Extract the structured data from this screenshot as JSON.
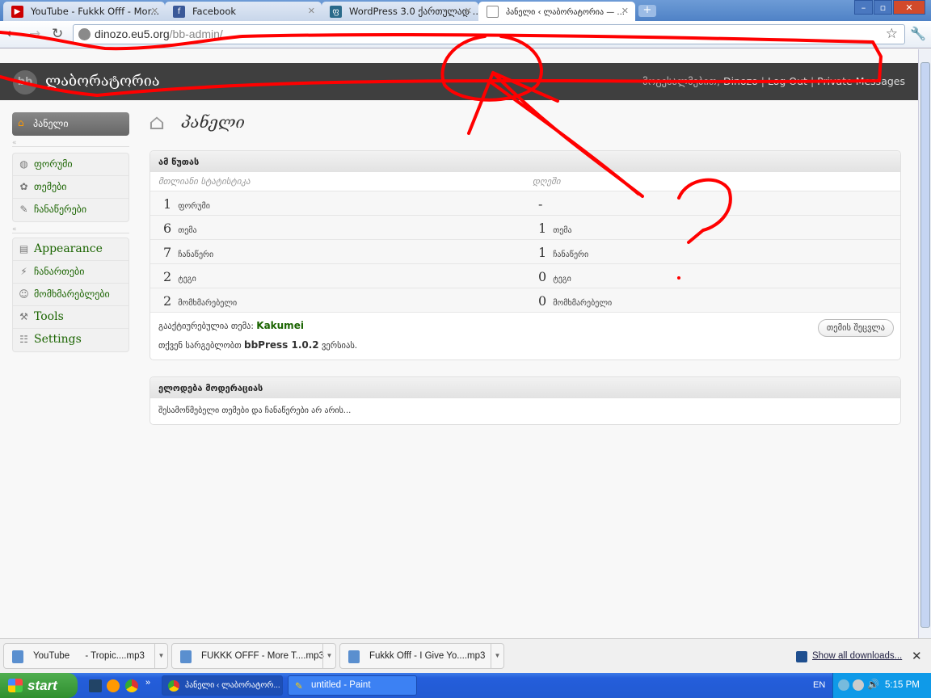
{
  "browser": {
    "tabs": [
      {
        "title": "YouTube - Fukkk Offf - Mor...",
        "icon": "youtube-icon"
      },
      {
        "title": "Facebook",
        "icon": "facebook-icon"
      },
      {
        "title": "WordPress 3.0 ქართულად ...",
        "icon": "wordpress-georgia-icon"
      },
      {
        "title": "პანელი ‹ ლაბორატორია — ...",
        "icon": "page-icon",
        "active": true
      }
    ],
    "url_host": "dinozo.eu5.org",
    "url_path": "/bb-admin/"
  },
  "site": {
    "title": "ლაბორატორია",
    "welcome": "მოგესალმებით, ",
    "username": "Dinozo",
    "logout": "Log Out",
    "messages": "Private Messages",
    "sep": " | "
  },
  "sidebar": {
    "dashboard": "პანელი",
    "group1": [
      "ფორუმი",
      "თემები",
      "ჩანაწერები"
    ],
    "group2": [
      "Appearance",
      "ჩანართები",
      "მომხმარებლები",
      "Tools",
      "Settings"
    ]
  },
  "main": {
    "title": "პანელი",
    "now": {
      "header": "ამ წუთას",
      "col_total": "მთლიანი სტატისტიკა",
      "col_day": "დღეში",
      "rows": [
        {
          "total": "1",
          "total_label": "ფორუმი",
          "day": "-",
          "day_label": ""
        },
        {
          "total": "6",
          "total_label": "თემა",
          "day": "1",
          "day_label": "თემა"
        },
        {
          "total": "7",
          "total_label": "ჩანაწერი",
          "day": "1",
          "day_label": "ჩანაწერი"
        },
        {
          "total": "2",
          "total_label": "ტეგი",
          "day": "0",
          "day_label": "ტეგი"
        },
        {
          "total": "2",
          "total_label": "მომხმარებელი",
          "day": "0",
          "day_label": "მომხმარებელი"
        }
      ],
      "theme_label": "გააქტიურებულია თემა: ",
      "theme_name": "Kakumei",
      "change_theme": "თემის შეცვლა",
      "version_prefix": "თქვენ სარგებლობთ ",
      "version": "bbPress 1.0.2",
      "version_suffix": " ვერსიას."
    },
    "moderation": {
      "header": "ელოდება მოდერაციას",
      "text": "შესამოწმებელი თემები და ჩანაწერები არ არის..."
    }
  },
  "downloads": {
    "items": [
      "YouTube      - Tropic....mp3",
      "FUKKK OFFF - More T....mp3",
      "Fukkk Offf - I Give Yo....mp3"
    ],
    "show_all": "Show all downloads...",
    "close": "✕"
  },
  "taskbar": {
    "start": "start",
    "windows": [
      "პანელი ‹ ლაბორატორ...",
      "untitled - Paint"
    ],
    "lang": "EN",
    "clock": "5:15 PM"
  },
  "colors": {
    "annotation": "#ff0000",
    "link_green": "#1a6400",
    "header_bg": "#3f3f3f"
  }
}
